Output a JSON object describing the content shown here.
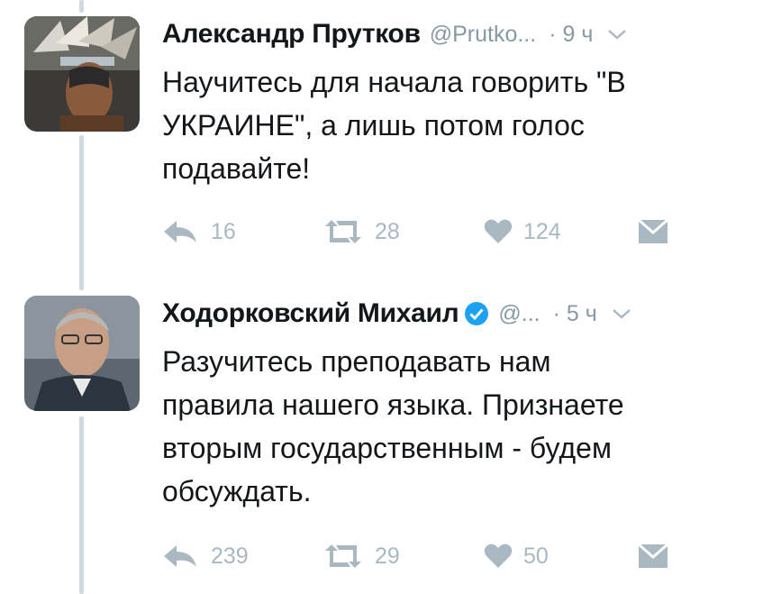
{
  "colors": {
    "text": "#14171a",
    "muted": "#8899a6",
    "action": "#aab8c2",
    "verified": "#1da1f2",
    "thread": "#cfd9de"
  },
  "tweets": [
    {
      "name": "Александр Прутков",
      "handle": "@Prutko...",
      "time": "· 9 ч",
      "verified": false,
      "lines": [
        "Научитесь для начала говорить \"В",
        "УКРАИНЕ\", а лишь потом голос",
        "подавайте!"
      ],
      "replies": "16",
      "retweets": "28",
      "likes": "124"
    },
    {
      "name": "Ходорковский Михаил",
      "handle": "@...",
      "time": "· 5 ч",
      "verified": true,
      "lines": [
        "Разучитесь преподавать нам",
        "правила нашего языка. Признаете",
        "вторым государственным - будем",
        "обсуждать."
      ],
      "replies": "239",
      "retweets": "29",
      "likes": "50"
    }
  ]
}
